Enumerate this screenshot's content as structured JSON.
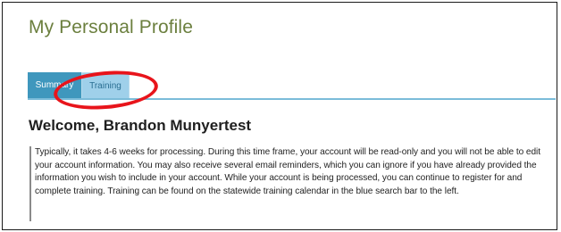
{
  "page": {
    "title": "My Personal Profile"
  },
  "tabs": [
    {
      "label": "Summary",
      "active": true
    },
    {
      "label": "Training",
      "active": false
    }
  ],
  "annotation": {
    "type": "red-ellipse-highlight",
    "color": "#e8141b",
    "target": "Training"
  },
  "main": {
    "welcome": "Welcome, Brandon Munyertest",
    "notice": "Typically, it takes 4-6 weeks for processing. During this time frame, your account will be read-only and you will not be able to edit your account information. You may also receive several email reminders, which you can ignore if you have already provided the information you wish to include in your account. While your account is being processed, you can continue to register for and complete training. Training can be found on the statewide training calendar in the blue search bar to the left."
  },
  "colors": {
    "title": "#6b7f3e",
    "tab_active_bg": "#3f97bd",
    "tab_inactive_bg": "#9fd0ea",
    "tab_underline": "#7bbcd9"
  }
}
